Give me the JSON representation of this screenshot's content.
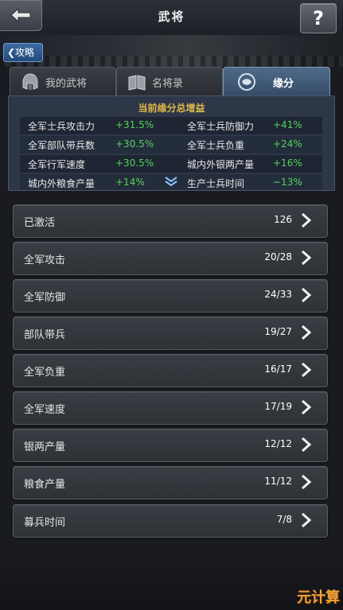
{
  "header": {
    "title": "武将",
    "help_label": "?"
  },
  "guide_tag": {
    "label": "攻略"
  },
  "tabs": [
    {
      "label": "我的武将",
      "icon": "helmet-icon",
      "active": false
    },
    {
      "label": "名将录",
      "icon": "book-icon",
      "active": false
    },
    {
      "label": "缘分",
      "icon": "fate-icon",
      "active": true
    }
  ],
  "summary": {
    "title": "当前缘分总增益",
    "rows": [
      {
        "left_label": "全军士兵攻击力",
        "left_value": "+31.5%",
        "right_label": "全军士兵防御力",
        "right_value": "+41%"
      },
      {
        "left_label": "全军部队带兵数",
        "left_value": "+30.5%",
        "right_label": "全军士兵负重",
        "right_value": "+24%"
      },
      {
        "left_label": "全军行军速度",
        "left_value": "+30.5%",
        "right_label": "城内外银两产量",
        "right_value": "+16%"
      },
      {
        "left_label": "城内外粮食产量",
        "left_value": "+14%",
        "right_label": "生产士兵时间",
        "right_value": "−13%"
      }
    ],
    "expand_icon": "double-chevron-down-icon"
  },
  "categories": [
    {
      "label": "已激活",
      "count": "126"
    },
    {
      "label": "全军攻击",
      "count": "20/28"
    },
    {
      "label": "全军防御",
      "count": "24/33"
    },
    {
      "label": "部队带兵",
      "count": "19/27"
    },
    {
      "label": "全军负重",
      "count": "16/17"
    },
    {
      "label": "全军速度",
      "count": "17/19"
    },
    {
      "label": "银两产量",
      "count": "12/12"
    },
    {
      "label": "粮食产量",
      "count": "11/12"
    },
    {
      "label": "募兵时间",
      "count": "7/8"
    }
  ],
  "watermark": "元计算",
  "colors": {
    "positive": "#53d45a",
    "panel_title": "#e0b94a",
    "active_tab": "#4f6b8a"
  }
}
